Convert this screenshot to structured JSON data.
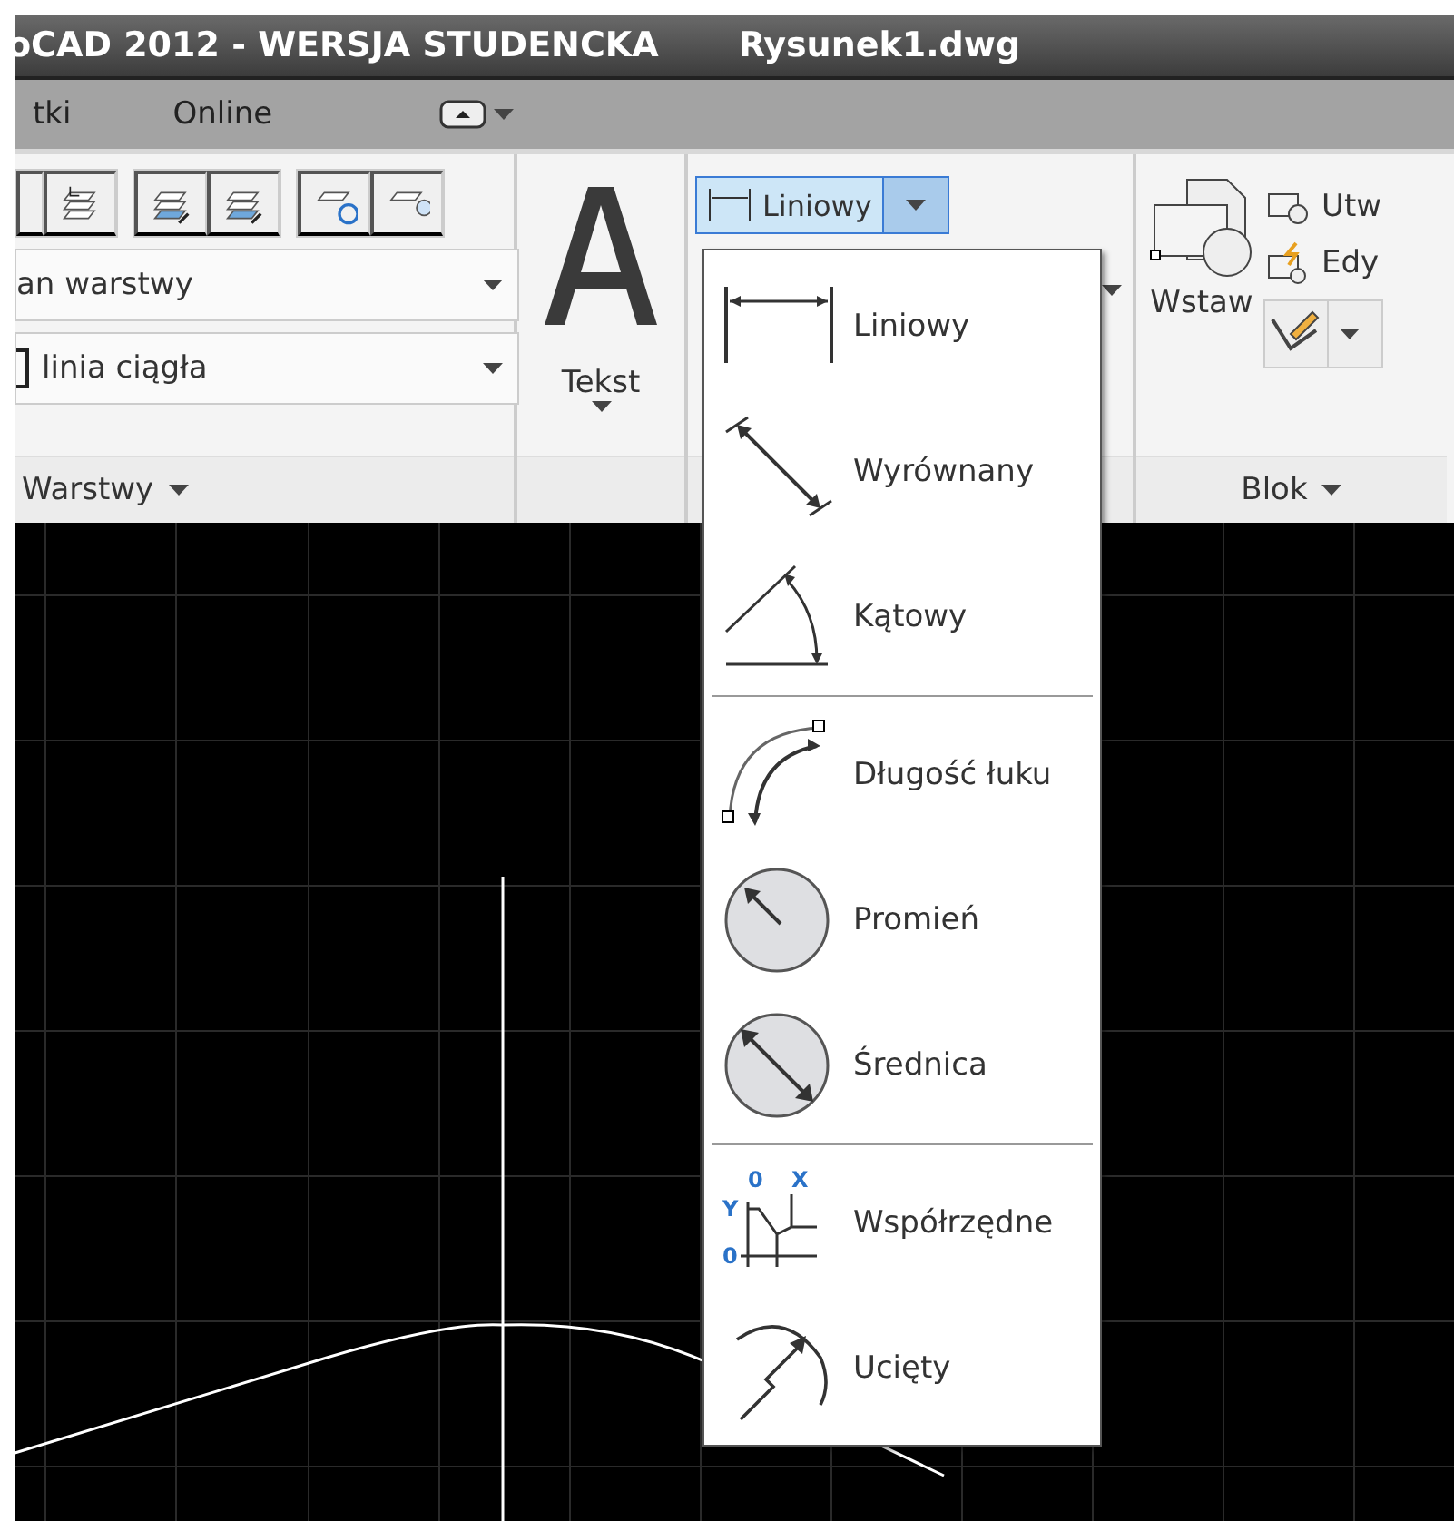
{
  "window": {
    "title": "oCAD 2012 - WERSJA STUDENCKA",
    "file": "Rysunek1.dwg"
  },
  "menu_tabs": [
    {
      "label": "tki",
      "selected": false
    },
    {
      "label": "Online",
      "selected": false
    }
  ],
  "layers_panel": {
    "layer_field": "an warstwy",
    "linetype_field": "linia ciągła",
    "title": "Warstwy"
  },
  "text_panel": {
    "label": "Tekst"
  },
  "dimension_button": {
    "label": "Liniowy",
    "open": true
  },
  "block_panel": {
    "insert": "Wstaw",
    "create": "Utw",
    "edit": "Edy",
    "title": "Blok"
  },
  "dropdown": {
    "groups": [
      [
        {
          "kind": "linear",
          "label": "Liniowy"
        },
        {
          "kind": "aligned",
          "label": "Wyrównany"
        },
        {
          "kind": "angular",
          "label": "Kątowy"
        }
      ],
      [
        {
          "kind": "arc",
          "label": "Długość łuku"
        },
        {
          "kind": "radius",
          "label": "Promień"
        },
        {
          "kind": "diameter",
          "label": "Średnica"
        }
      ],
      [
        {
          "kind": "ordinate",
          "label": "Współrzędne",
          "axis_labels": [
            "0",
            "X",
            "Y",
            "0"
          ]
        },
        {
          "kind": "jogged",
          "label": "Ucięty"
        }
      ]
    ]
  }
}
